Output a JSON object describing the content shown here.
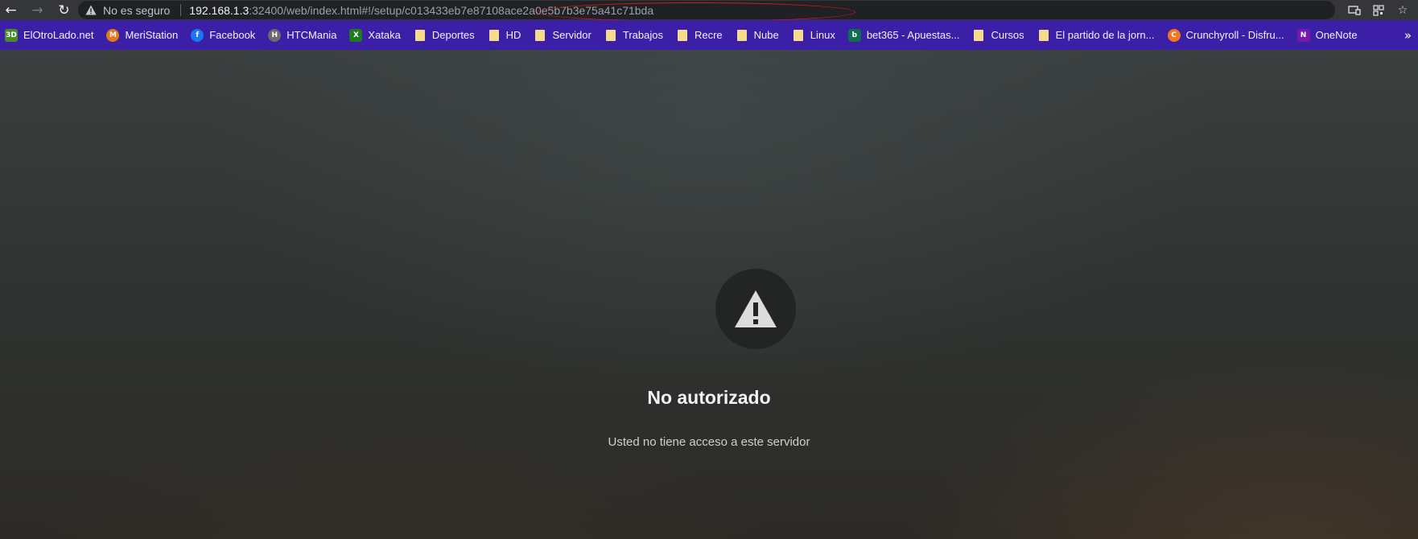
{
  "browser": {
    "security_text": "No es seguro",
    "url_host": "192.168.1.3",
    "url_rest": ":32400/web/index.html#!/setup/c013433eb7e87108ace2a0e5b7b3e75a41c71bda",
    "icons": {
      "back": "back-arrow-icon",
      "forward": "forward-arrow-icon",
      "reload": "reload-icon",
      "security": "warning-triangle-icon",
      "cast": "cast-icon",
      "apps": "qr-apps-icon",
      "bookmark_star": "star-icon"
    },
    "highlight_color": "#d01a1a"
  },
  "bookmarks": [
    {
      "label": "ElOtroLado.net",
      "icon": "elotrolado-icon",
      "color": "#4a8a2a",
      "glyph": "3D"
    },
    {
      "label": "MeriStation",
      "icon": "meristation-icon",
      "color": "#e07b1c",
      "glyph": "M"
    },
    {
      "label": "Facebook",
      "icon": "facebook-icon",
      "color": "#1877f2",
      "glyph": "f"
    },
    {
      "label": "HTCMania",
      "icon": "htcmania-icon",
      "color": "#6b6b6b",
      "glyph": "H"
    },
    {
      "label": "Xataka",
      "icon": "xataka-icon",
      "color": "#1e7a1e",
      "glyph": "X"
    },
    {
      "label": "Deportes",
      "icon": "folder-icon"
    },
    {
      "label": "HD",
      "icon": "folder-icon"
    },
    {
      "label": "Servidor",
      "icon": "folder-icon"
    },
    {
      "label": "Trabajos",
      "icon": "folder-icon"
    },
    {
      "label": "Recre",
      "icon": "folder-icon"
    },
    {
      "label": "Nube",
      "icon": "folder-icon"
    },
    {
      "label": "Linux",
      "icon": "folder-icon"
    },
    {
      "label": "bet365 - Apuestas...",
      "icon": "bet365-icon",
      "color": "#126e51",
      "glyph": "b"
    },
    {
      "label": "Cursos",
      "icon": "folder-icon"
    },
    {
      "label": "El partido de la jorn...",
      "icon": "folder-icon"
    },
    {
      "label": "Crunchyroll - Disfru...",
      "icon": "crunchyroll-icon",
      "color": "#f47521",
      "glyph": "C"
    },
    {
      "label": "OneNote",
      "icon": "onenote-icon",
      "color": "#7719aa",
      "glyph": "N"
    }
  ],
  "overflow_label": "»",
  "content": {
    "icon": "alert-triangle-icon",
    "title": "No autorizado",
    "message": "Usted no tiene acceso a este servidor"
  }
}
